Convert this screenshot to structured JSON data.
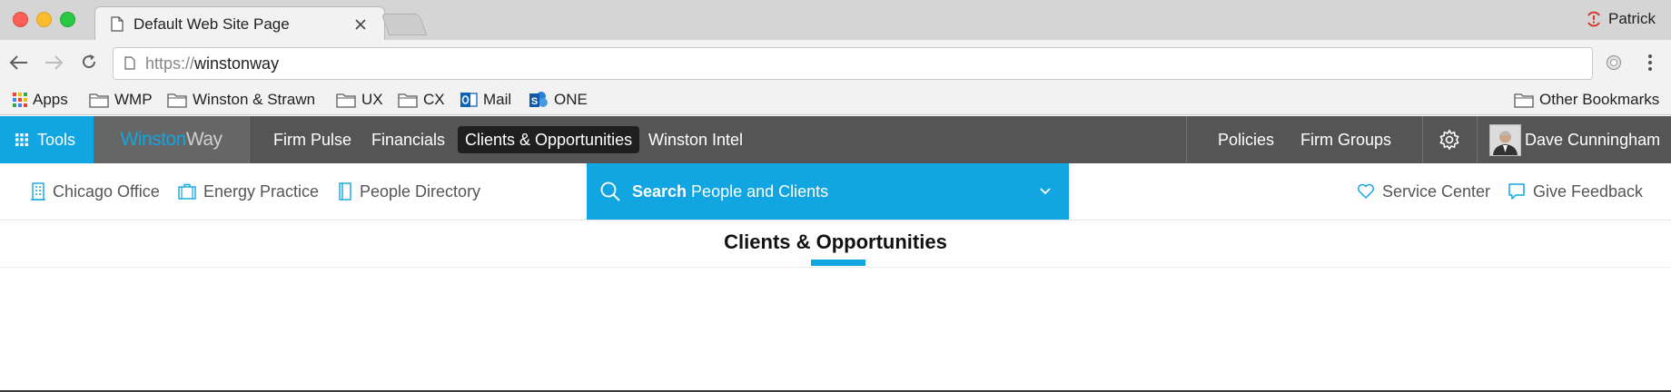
{
  "browser": {
    "tab_title": "Default Web Site Page",
    "profile_name": "Patrick",
    "url_scheme": "https://",
    "url_host": "winstonway",
    "bookmarks": [
      {
        "label": "Apps",
        "icon": "apps-grid-icon"
      },
      {
        "label": "WMP",
        "icon": "folder-icon"
      },
      {
        "label": "Winston & Strawn",
        "icon": "folder-icon"
      },
      {
        "label": "UX",
        "icon": "folder-icon"
      },
      {
        "label": "CX",
        "icon": "folder-icon"
      },
      {
        "label": "Mail",
        "icon": "outlook-icon"
      },
      {
        "label": "ONE",
        "icon": "sharepoint-icon"
      }
    ],
    "other_bookmarks": "Other Bookmarks"
  },
  "app": {
    "tools_label": "Tools",
    "logo_part1": "Winston",
    "logo_part2": "Way",
    "nav": [
      "Firm Pulse",
      "Financials",
      "Clients & Opportunities",
      "Winston Intel"
    ],
    "active_nav": "Clients & Opportunities",
    "right_nav": [
      "Policies",
      "Firm Groups"
    ],
    "user_name": "Dave Cunningham",
    "colors": {
      "accent": "#11a5e2",
      "nav_bg": "#555555",
      "active_bg": "#1f1f1f"
    }
  },
  "subbar": {
    "links": [
      "Chicago Office",
      "Energy Practice",
      "People Directory"
    ],
    "search_bold": "Search",
    "search_rest": "People and Clients",
    "right_links": [
      "Service Center",
      "Give Feedback"
    ]
  },
  "page": {
    "heading": "Clients & Opportunities"
  }
}
